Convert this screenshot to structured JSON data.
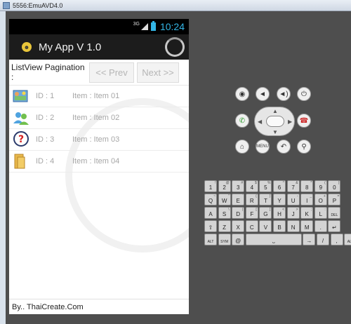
{
  "window": {
    "title": "5556:EmuAVD4.0"
  },
  "statusbar": {
    "network": "3G",
    "time": "10:24"
  },
  "actionbar": {
    "title": "My App V 1.0"
  },
  "pager": {
    "label": "ListView Pagination :",
    "prev_label": "<< Prev",
    "next_label": "Next >>"
  },
  "list": {
    "rows": [
      {
        "id": "ID : 1",
        "item": "Item : Item 01",
        "icon": "photo-icon"
      },
      {
        "id": "ID : 2",
        "item": "Item : Item 02",
        "icon": "users-icon"
      },
      {
        "id": "ID : 3",
        "item": "Item : Item 03",
        "icon": "help-icon"
      },
      {
        "id": "ID : 4",
        "item": "Item : Item 04",
        "icon": "folder-icon"
      }
    ]
  },
  "footer": {
    "text": "By.. ThaiCreate.Com"
  },
  "controls": {
    "camera": "camera-icon",
    "vol_down": "volume-down-icon",
    "vol_up": "volume-up-icon",
    "power": "power-icon",
    "call": "call-icon",
    "end_call": "end-call-icon",
    "home": "home-icon",
    "menu": "MENU",
    "back": "back-icon",
    "search": "search-icon"
  },
  "keyboard": {
    "row1": [
      [
        "1",
        "!"
      ],
      [
        "2",
        "@"
      ],
      [
        "3",
        "#"
      ],
      [
        "4",
        "$"
      ],
      [
        "5",
        "%"
      ],
      [
        "6",
        "^"
      ],
      [
        "7",
        "&"
      ],
      [
        "8",
        "*"
      ],
      [
        "9",
        "("
      ],
      [
        "0",
        ")"
      ]
    ],
    "row2": [
      [
        "Q",
        "~"
      ],
      [
        "W",
        "\""
      ],
      [
        "E",
        "`"
      ],
      [
        "R",
        "{"
      ],
      [
        "T",
        "}"
      ],
      [
        "Y",
        ""
      ],
      [
        "U",
        "-"
      ],
      [
        "I",
        "_"
      ],
      [
        "O",
        "+"
      ],
      [
        "P",
        "="
      ]
    ],
    "row3": [
      [
        "A",
        ""
      ],
      [
        "S",
        "\\"
      ],
      [
        "D",
        "|"
      ],
      [
        "F",
        "["
      ],
      [
        "G",
        "]"
      ],
      [
        "H",
        "<"
      ],
      [
        "J",
        ">"
      ],
      [
        "K",
        ";"
      ],
      [
        "L",
        ":"
      ],
      [
        "DEL",
        ""
      ]
    ],
    "row4": [
      [
        "⇧",
        ""
      ],
      [
        "Z",
        ""
      ],
      [
        "X",
        ""
      ],
      [
        "C",
        ""
      ],
      [
        "V",
        ""
      ],
      [
        "B",
        ""
      ],
      [
        "N",
        ""
      ],
      [
        "M",
        ""
      ],
      [
        ".",
        ""
      ],
      [
        "↵",
        ""
      ]
    ],
    "row5": [
      [
        "ALT",
        ""
      ],
      [
        "SYM",
        ""
      ],
      [
        "@",
        ""
      ],
      [
        "⎵",
        ""
      ],
      [
        "→",
        ""
      ],
      [
        "/",
        ""
      ],
      [
        ",",
        ""
      ],
      [
        "ALT",
        ""
      ]
    ]
  },
  "colors": {
    "accent": "#33b5e5",
    "actionbar": "#1c1c1c",
    "emulator_bg": "#4e4e4e"
  }
}
